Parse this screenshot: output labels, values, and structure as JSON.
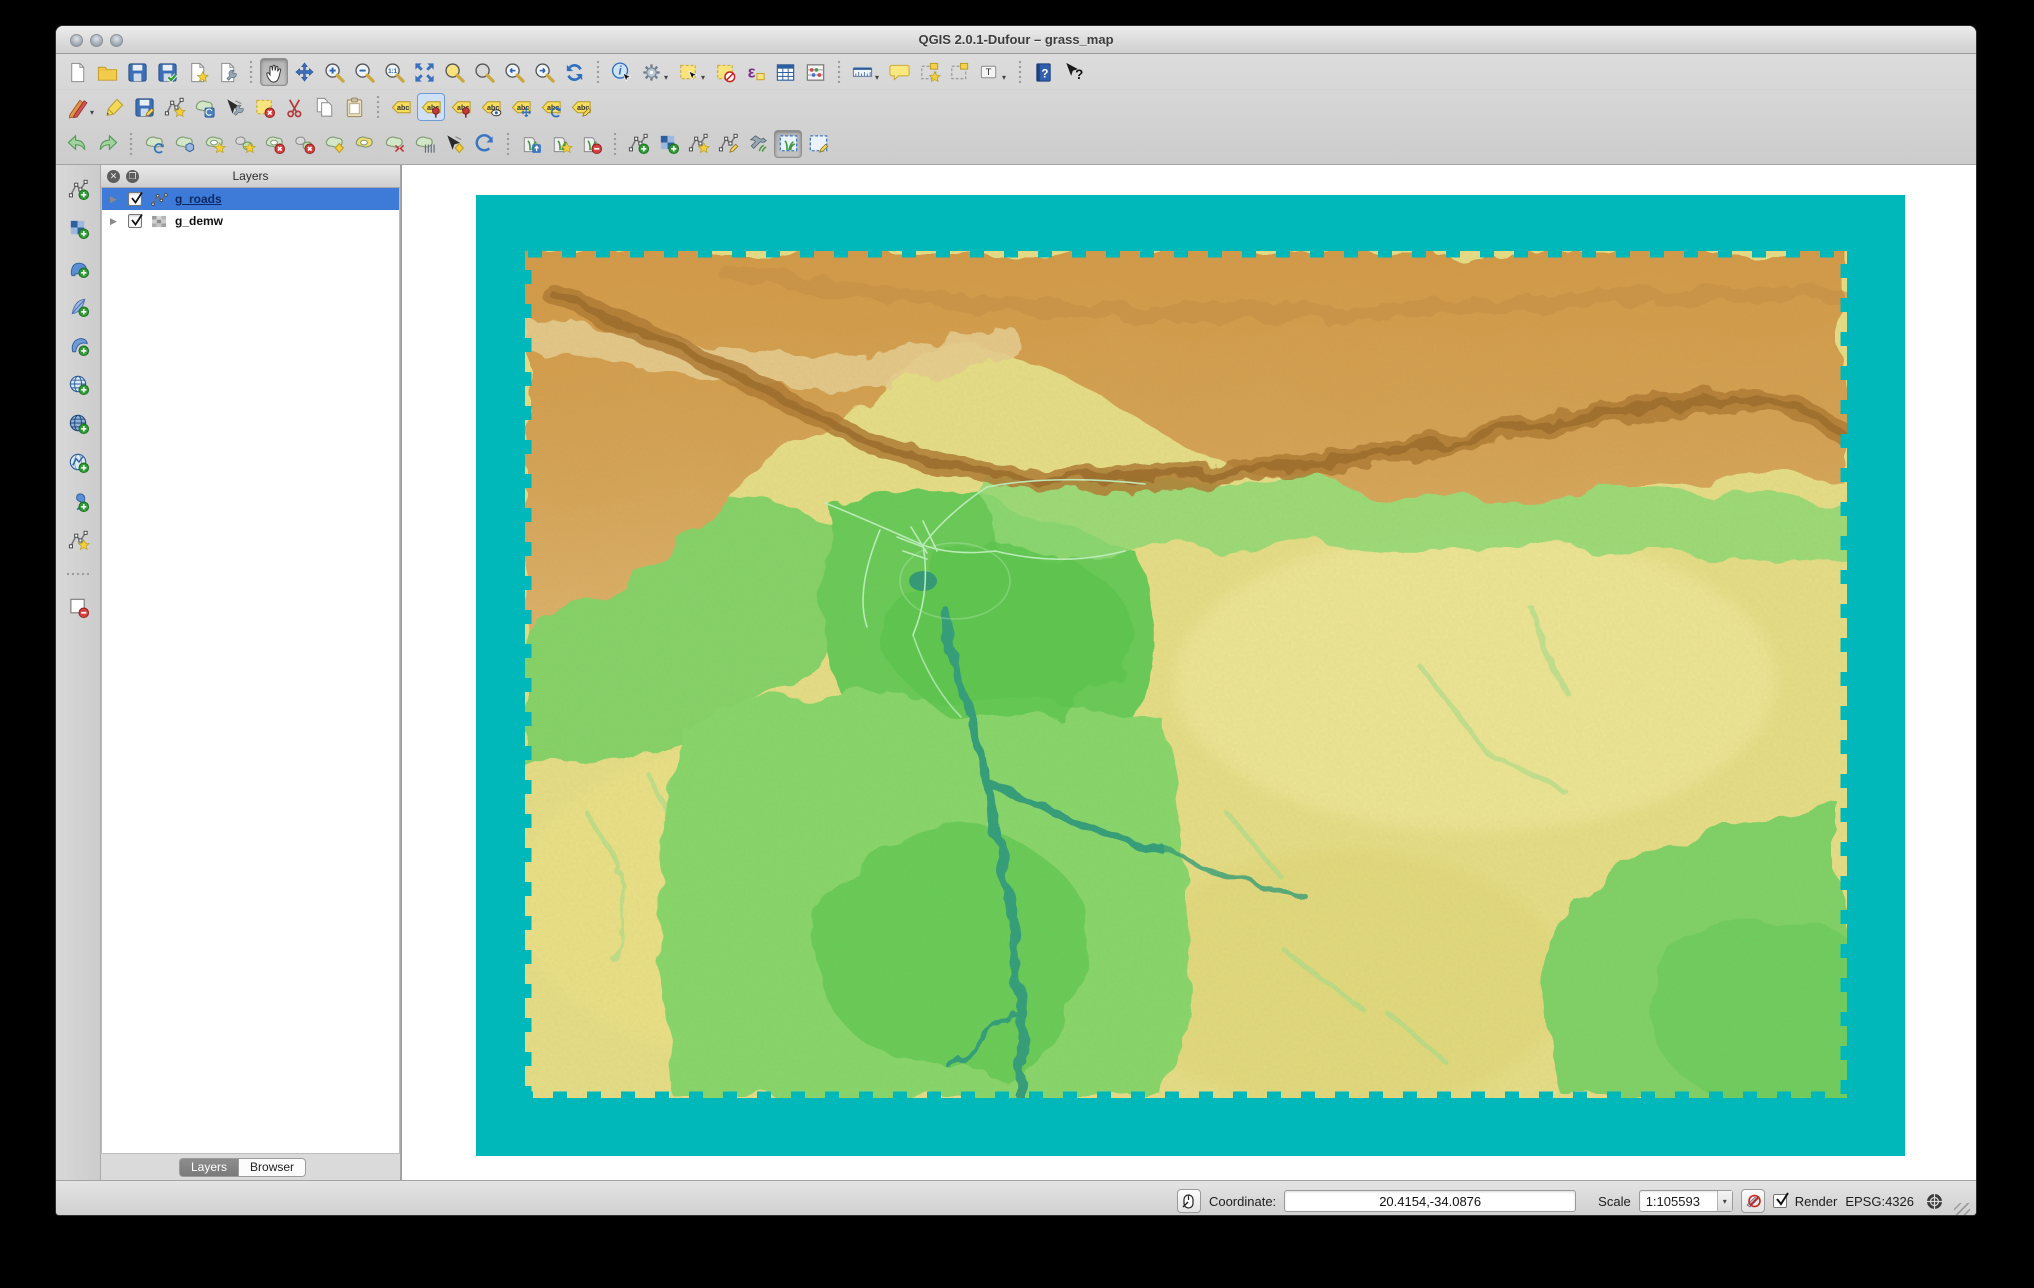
{
  "window": {
    "title": "QGIS 2.0.1-Dufour – grass_map"
  },
  "colors": {
    "selection_blue": "#3e7bd8",
    "canvas_teal": "#00b8ba",
    "dem_yellow": "#e8e088",
    "dem_orange_high": "#d49a47",
    "dem_orange_low": "#ddb169",
    "dem_green": "#6fd35f",
    "dem_channel_teal": "#2f9f7b",
    "roads_light_green": "#c2f4c6"
  },
  "toolbars": {
    "row1": [
      {
        "name": "new-project",
        "base": "page"
      },
      {
        "name": "open-project",
        "base": "folder"
      },
      {
        "name": "save-project",
        "base": "floppy"
      },
      {
        "name": "save-project-as",
        "base": "floppy",
        "badge": "check"
      },
      {
        "name": "new-print-composer",
        "base": "page",
        "badge": "star"
      },
      {
        "name": "composer-manager",
        "base": "page",
        "badge": "wrench"
      },
      {
        "sep": 1
      },
      {
        "name": "pan-map",
        "base": "hand",
        "active": 1
      },
      {
        "name": "pan-to-selection",
        "base": "arrows4"
      },
      {
        "name": "zoom-in",
        "base": "mag",
        "opt": "plus"
      },
      {
        "name": "zoom-out",
        "base": "mag",
        "opt": "minus"
      },
      {
        "name": "zoom-native",
        "base": "mag",
        "opt": "one"
      },
      {
        "name": "zoom-full",
        "base": "expand4"
      },
      {
        "name": "zoom-to-selection",
        "base": "mag",
        "opt": "ysel"
      },
      {
        "name": "zoom-to-layer",
        "base": "mag",
        "opt": "grey"
      },
      {
        "name": "zoom-last",
        "base": "mag",
        "opt": "left"
      },
      {
        "name": "zoom-next",
        "base": "mag",
        "opt": "right"
      },
      {
        "name": "refresh-map",
        "base": "refresh"
      },
      {
        "sep": 1
      },
      {
        "name": "identify-features",
        "base": "info"
      },
      {
        "name": "run-feature-action",
        "base": "gear",
        "dropdown": 1
      },
      {
        "name": "select-features",
        "base": "ysq",
        "badge": "cursor",
        "dropdown": 1
      },
      {
        "name": "deselect-features",
        "base": "ysq",
        "badge": "slash"
      },
      {
        "name": "select-by-expression",
        "base": "eps"
      },
      {
        "name": "open-attribute-table",
        "base": "table"
      },
      {
        "name": "field-calculator",
        "base": "abacus"
      },
      {
        "sep": 1
      },
      {
        "name": "measure-line",
        "base": "ruler",
        "dropdown": 1
      },
      {
        "name": "map-tips",
        "base": "bubble"
      },
      {
        "name": "new-bookmark",
        "base": "bmark",
        "badge": "star"
      },
      {
        "name": "show-bookmarks",
        "base": "bmark"
      },
      {
        "name": "text-annotation",
        "base": "annot",
        "dropdown": 1
      },
      {
        "sep": 1
      },
      {
        "name": "help-contents",
        "base": "helpbook"
      },
      {
        "name": "whats-this",
        "base": "cursorQ"
      }
    ],
    "row2": [
      {
        "name": "current-edits",
        "base": "pencils2",
        "dropdown": 1
      },
      {
        "name": "toggle-editing",
        "base": "pencil"
      },
      {
        "name": "save-layer-edits",
        "base": "floppy",
        "badge": "pencilB"
      },
      {
        "name": "add-feature",
        "base": "vnode",
        "badge": "star"
      },
      {
        "name": "move-feature",
        "base": "blob",
        "badge": "bluebox"
      },
      {
        "name": "node-tool",
        "base": "nodetool",
        "badge": "wrench"
      },
      {
        "name": "delete-selected",
        "base": "ysq",
        "badge": "x"
      },
      {
        "name": "cut-features",
        "base": "scissors"
      },
      {
        "name": "copy-features",
        "base": "copy2"
      },
      {
        "name": "paste-features",
        "base": "clipboard"
      },
      {
        "sep": 1
      },
      {
        "name": "labeling-options",
        "base": "abctag"
      },
      {
        "name": "pin-labels",
        "base": "abctag",
        "badge": "pin",
        "highlight": 1
      },
      {
        "name": "highlight-pinned-labels",
        "base": "abctag",
        "badge": "pin"
      },
      {
        "name": "show-hide-labels",
        "base": "abctag",
        "badge": "eye"
      },
      {
        "name": "move-label",
        "base": "abctag",
        "badge": "move"
      },
      {
        "name": "rotate-label",
        "base": "abctag",
        "badge": "rotate"
      },
      {
        "name": "change-label",
        "base": "abctag",
        "badge": "pencilB"
      }
    ],
    "row3": [
      {
        "name": "undo",
        "base": "garrowL"
      },
      {
        "name": "redo",
        "base": "garrowR"
      },
      {
        "sep": 1
      },
      {
        "name": "rotate-feature",
        "base": "blob",
        "badge": "rotate"
      },
      {
        "name": "simplify-feature",
        "base": "blob",
        "badge": "hex"
      },
      {
        "name": "add-ring",
        "base": "blobring",
        "badge": "star"
      },
      {
        "name": "add-part",
        "base": "blob2",
        "badge": "star"
      },
      {
        "name": "delete-ring",
        "base": "blobring",
        "badge": "x"
      },
      {
        "name": "delete-part",
        "base": "blob2",
        "badge": "x"
      },
      {
        "name": "reshape-features",
        "base": "blob",
        "badge": "diamond"
      },
      {
        "name": "offset-curve",
        "base": "blobring",
        "opt": "yellow"
      },
      {
        "name": "split-features",
        "base": "blob",
        "badge": "split"
      },
      {
        "name": "merge-features",
        "base": "blob",
        "badge": "comb"
      },
      {
        "name": "vertex-tool",
        "base": "nodetool",
        "badge": "diamond"
      },
      {
        "name": "rotate-point-symbols",
        "base": "rotatept"
      },
      {
        "sep": 1
      },
      {
        "name": "open-mapset",
        "base": "grass",
        "badge": "up"
      },
      {
        "name": "new-mapset",
        "base": "grass",
        "badge": "star"
      },
      {
        "name": "close-mapset",
        "base": "grass",
        "badge": "minus"
      },
      {
        "sep": 1
      },
      {
        "name": "add-grass-vector-layer",
        "base": "vnode",
        "badge": "plus"
      },
      {
        "name": "add-grass-raster-layer",
        "base": "vgrid",
        "badge": "plus"
      },
      {
        "name": "create-new-grass-vector",
        "base": "vnode",
        "badge": "star"
      },
      {
        "name": "edit-grass-vector-layer",
        "base": "vnode",
        "badge": "pencilB"
      },
      {
        "name": "open-grass-tools",
        "base": "hammer"
      },
      {
        "name": "display-current-grass-region",
        "base": "region",
        "opt": "grass",
        "active": 1
      },
      {
        "name": "edit-current-grass-region",
        "base": "region",
        "badge": "pencilB"
      }
    ],
    "left": [
      {
        "name": "add-vector-layer",
        "base": "vnode",
        "badge": "plus"
      },
      {
        "name": "add-raster-layer",
        "base": "vgrid",
        "badge": "plus"
      },
      {
        "name": "add-postgis-layer",
        "base": "elephant",
        "badge": "plus"
      },
      {
        "name": "add-spatialite-layer",
        "base": "feather",
        "badge": "plus"
      },
      {
        "name": "add-mssql-layer",
        "base": "shell",
        "badge": "plus"
      },
      {
        "name": "add-wms-layer",
        "base": "globe",
        "badge": "plus"
      },
      {
        "name": "add-wcs-layer",
        "base": "globe2",
        "badge": "plus"
      },
      {
        "name": "add-wfs-layer",
        "base": "globeV",
        "badge": "plus"
      },
      {
        "name": "add-delimited-text-layer",
        "base": "comma",
        "badge": "plus"
      },
      {
        "name": "new-shapefile-layer",
        "base": "vnode",
        "badge": "star"
      },
      {
        "sep": 1
      },
      {
        "name": "remove-layer",
        "base": "sqminus",
        "badge": "minus"
      }
    ]
  },
  "layers_panel": {
    "title": "Layers",
    "items": [
      {
        "label": "g_roads",
        "checked": true,
        "selected": true,
        "kind": "vector"
      },
      {
        "label": "g_demw",
        "checked": true,
        "selected": false,
        "kind": "raster"
      }
    ],
    "tabs": [
      {
        "label": "Layers",
        "active": true
      },
      {
        "label": "Browser",
        "active": false
      }
    ]
  },
  "status_bar": {
    "coordinate_label": "Coordinate:",
    "coordinate_value": "20.4154,-34.0876",
    "scale_label": "Scale",
    "scale_value": "1:105593",
    "render_label": "Render",
    "crs_label": "EPSG:4326"
  }
}
